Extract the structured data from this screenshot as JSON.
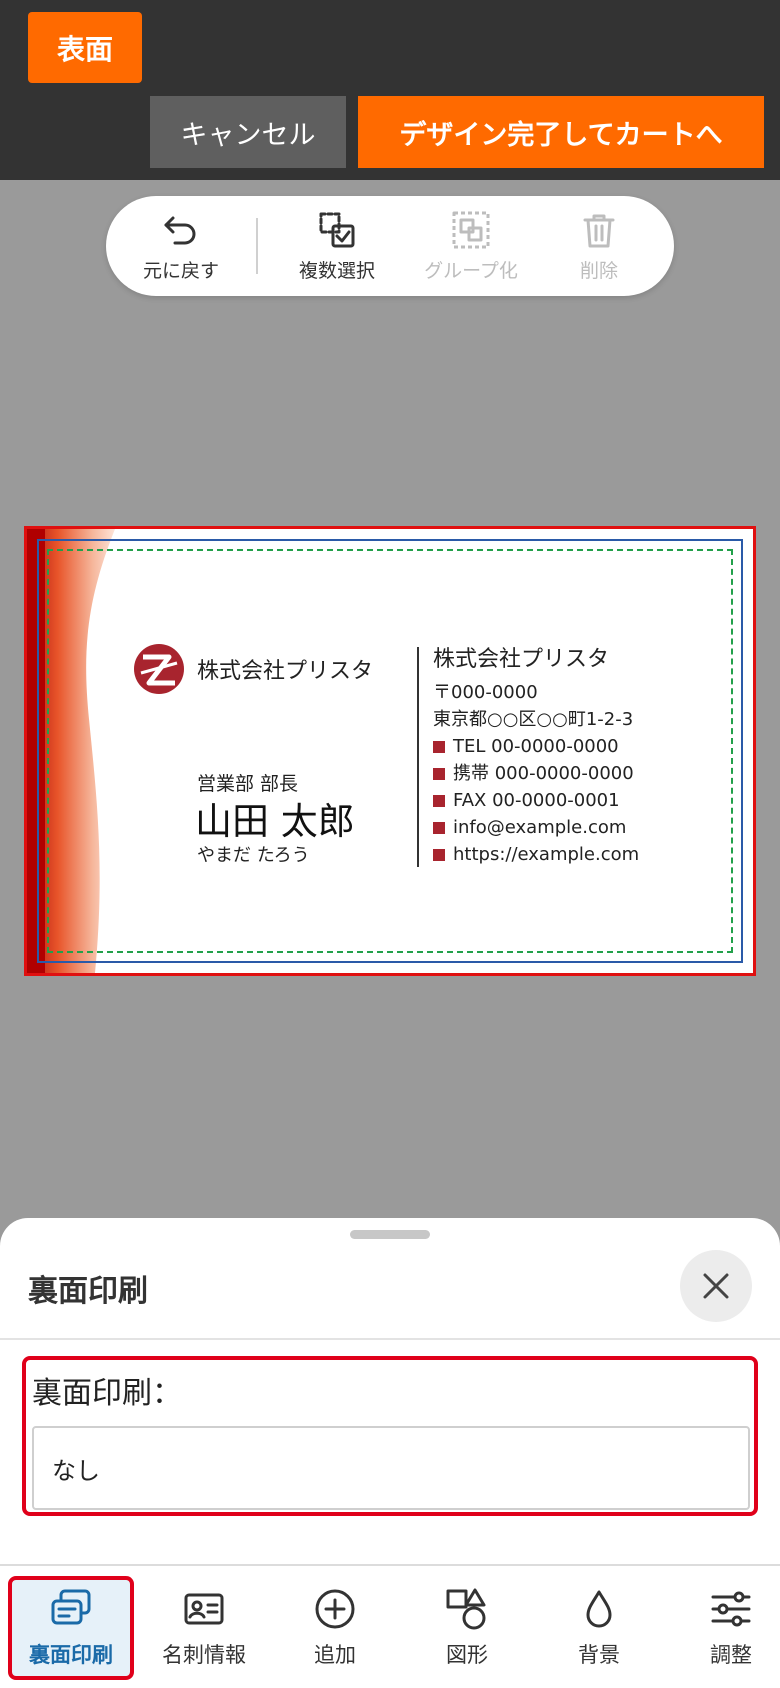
{
  "header": {
    "side_label": "表面",
    "cancel_label": "キャンセル",
    "finish_label": "デザイン完了してカートへ"
  },
  "toolbar": {
    "undo_label": "元に戻す",
    "multi_select_label": "複数選択",
    "group_label": "グループ化",
    "delete_label": "削除"
  },
  "card": {
    "company_left": "株式会社プリスタ",
    "position": "営業部 部長",
    "name": "山田 太郎",
    "kana": "やまだ たろう",
    "company_right": "株式会社プリスタ",
    "postal": "〒000-0000",
    "address": "東京都○○区○○町1-2-3",
    "tel": "TEL 00-0000-0000",
    "mobile": "携帯 000-0000-0000",
    "fax": "FAX 00-0000-0001",
    "email": "info@example.com",
    "url": "https://example.com",
    "accent_color": "#a8242e"
  },
  "sheet": {
    "title": "裏面印刷",
    "field_label": "裏面印刷：",
    "field_value": "なし"
  },
  "bottom_nav": [
    {
      "label": "裏面印刷",
      "icon": "back-print-icon",
      "active": true
    },
    {
      "label": "名刺情報",
      "icon": "id-card-icon",
      "active": false
    },
    {
      "label": "追加",
      "icon": "add-circle-icon",
      "active": false
    },
    {
      "label": "図形",
      "icon": "shapes-icon",
      "active": false
    },
    {
      "label": "背景",
      "icon": "drop-icon",
      "active": false
    },
    {
      "label": "調整",
      "icon": "sliders-icon",
      "active": false
    }
  ],
  "colors": {
    "brand_orange": "#ff6a00",
    "header_bg": "#333333",
    "highlight_red": "#e0001a",
    "active_blue": "#1a6aa8"
  }
}
